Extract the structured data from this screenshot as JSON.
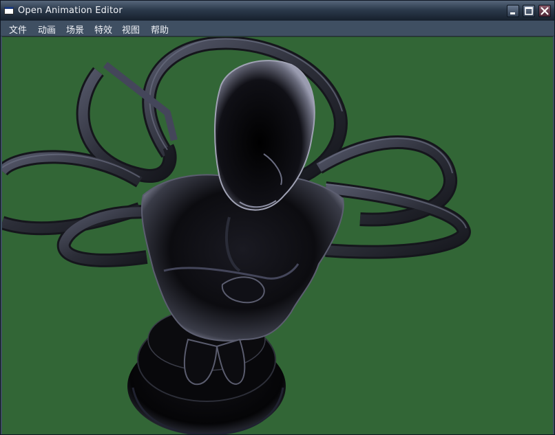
{
  "window": {
    "title": "Open Animation Editor",
    "icon": "window-app-icon",
    "controls": [
      "minimize-icon",
      "maximize-icon",
      "close-icon"
    ]
  },
  "menu": {
    "items": [
      {
        "label": "文件"
      },
      {
        "label": "动画"
      },
      {
        "label": "场景"
      },
      {
        "label": "特效"
      },
      {
        "label": "视图"
      },
      {
        "label": "帮助"
      }
    ]
  },
  "viewport": {
    "background": "#326636",
    "subject": "dark-chrome-figure-on-pedestal",
    "ribbons": "dark-metallic-petal-loops"
  },
  "colors": {
    "titlebar": "#2c3a4c",
    "menubar": "#3f4f62",
    "viewport_bg": "#326636",
    "figure": "#0c0c10",
    "ribbon": "#3a3c48"
  }
}
